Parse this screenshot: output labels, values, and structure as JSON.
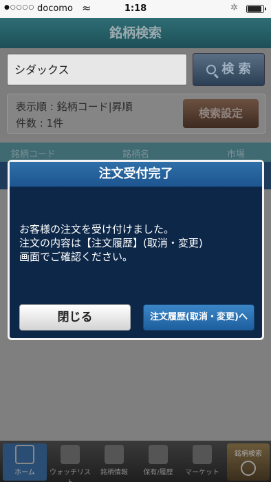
{
  "status_bar": {
    "signal": "●○○○○",
    "carrier": "docomo",
    "time": "1:18"
  },
  "header": {
    "title": "銘柄検索"
  },
  "search": {
    "value": "シダックス",
    "button_label": "検 索"
  },
  "info": {
    "sort_order": "表示順 : 銘柄コード|昇順",
    "count": "件数 : 1件",
    "settings_button": "検索設定"
  },
  "table": {
    "columns": [
      "銘柄コード",
      "銘柄名",
      "市場"
    ]
  },
  "modal": {
    "title": "注文受付完了",
    "message": [
      "お客様の注文を受け付けました。",
      "注文の内容は【注文履歴】(取消・変更)",
      "画面でご確認ください。"
    ],
    "close_button": "閉じる",
    "history_button": "注文履歴(取消・変更)へ"
  },
  "tabbar": {
    "items": [
      {
        "label": "ホーム",
        "icon": "home-grid-icon"
      },
      {
        "label": "ウォッチリスト",
        "icon": "star-folder-icon"
      },
      {
        "label": "銘柄情報",
        "icon": "info-chart-icon"
      },
      {
        "label": "保有/履歴",
        "icon": "clipboard-icon"
      },
      {
        "label": "マーケット",
        "icon": "globe-icon"
      }
    ],
    "search_shortcut": "銘柄検索"
  }
}
